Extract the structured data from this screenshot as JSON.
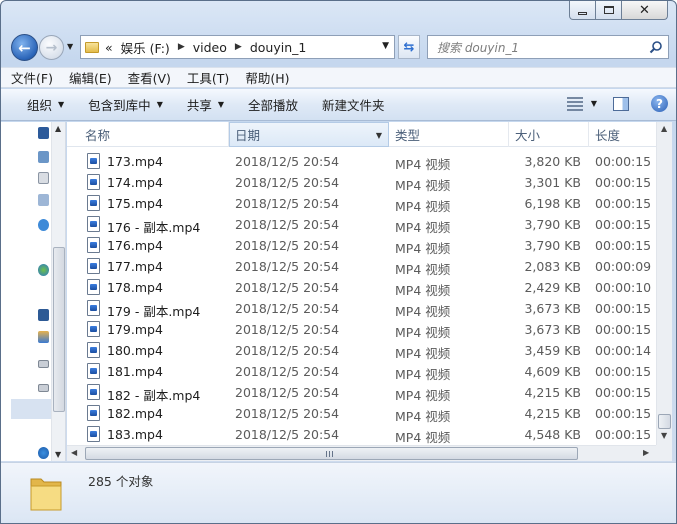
{
  "address": {
    "overflow": "«",
    "segments": [
      "娱乐 (F:)",
      "video",
      "douyin_1"
    ]
  },
  "search": {
    "placeholder": "搜索 douyin_1"
  },
  "menu": [
    "文件(F)",
    "编辑(E)",
    "查看(V)",
    "工具(T)",
    "帮助(H)"
  ],
  "toolbar": {
    "organize": "组织",
    "include_library": "包含到库中",
    "share": "共享",
    "play_all": "全部播放",
    "new_folder": "新建文件夹"
  },
  "columns": {
    "name": "名称",
    "date": "日期",
    "type": "类型",
    "size": "大小",
    "duration": "长度"
  },
  "files": [
    {
      "name": "173.mp4",
      "date": "2018/12/5 20:54",
      "type": "MP4 视频",
      "size": "3,820 KB",
      "duration": "00:00:15"
    },
    {
      "name": "174.mp4",
      "date": "2018/12/5 20:54",
      "type": "MP4 视频",
      "size": "3,301 KB",
      "duration": "00:00:15"
    },
    {
      "name": "175.mp4",
      "date": "2018/12/5 20:54",
      "type": "MP4 视频",
      "size": "6,198 KB",
      "duration": "00:00:15"
    },
    {
      "name": "176 - 副本.mp4",
      "date": "2018/12/5 20:54",
      "type": "MP4 视频",
      "size": "3,790 KB",
      "duration": "00:00:15"
    },
    {
      "name": "176.mp4",
      "date": "2018/12/5 20:54",
      "type": "MP4 视频",
      "size": "3,790 KB",
      "duration": "00:00:15"
    },
    {
      "name": "177.mp4",
      "date": "2018/12/5 20:54",
      "type": "MP4 视频",
      "size": "2,083 KB",
      "duration": "00:00:09"
    },
    {
      "name": "178.mp4",
      "date": "2018/12/5 20:54",
      "type": "MP4 视频",
      "size": "2,429 KB",
      "duration": "00:00:10"
    },
    {
      "name": "179 - 副本.mp4",
      "date": "2018/12/5 20:54",
      "type": "MP4 视频",
      "size": "3,673 KB",
      "duration": "00:00:15"
    },
    {
      "name": "179.mp4",
      "date": "2018/12/5 20:54",
      "type": "MP4 视频",
      "size": "3,673 KB",
      "duration": "00:00:15"
    },
    {
      "name": "180.mp4",
      "date": "2018/12/5 20:54",
      "type": "MP4 视频",
      "size": "3,459 KB",
      "duration": "00:00:14"
    },
    {
      "name": "181.mp4",
      "date": "2018/12/5 20:54",
      "type": "MP4 视频",
      "size": "4,609 KB",
      "duration": "00:00:15"
    },
    {
      "name": "182 - 副本.mp4",
      "date": "2018/12/5 20:54",
      "type": "MP4 视频",
      "size": "4,215 KB",
      "duration": "00:00:15"
    },
    {
      "name": "182.mp4",
      "date": "2018/12/5 20:54",
      "type": "MP4 视频",
      "size": "4,215 KB",
      "duration": "00:00:15"
    },
    {
      "name": "183.mp4",
      "date": "2018/12/5 20:54",
      "type": "MP4 视频",
      "size": "4,548 KB",
      "duration": "00:00:15"
    }
  ],
  "status": {
    "count": "285 个对象"
  }
}
